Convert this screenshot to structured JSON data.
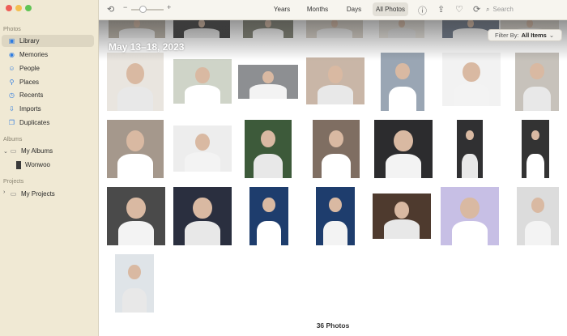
{
  "sidebar": {
    "sections": {
      "photos": "Photos",
      "albums": "Albums",
      "projects": "Projects"
    },
    "items": [
      {
        "label": "Library",
        "icon": "library-icon",
        "selected": true
      },
      {
        "label": "Memories",
        "icon": "memories-icon"
      },
      {
        "label": "People",
        "icon": "people-icon"
      },
      {
        "label": "Places",
        "icon": "places-icon"
      },
      {
        "label": "Recents",
        "icon": "recents-icon"
      },
      {
        "label": "Imports",
        "icon": "imports-icon"
      },
      {
        "label": "Duplicates",
        "icon": "duplicates-icon"
      }
    ],
    "my_albums": "My Albums",
    "album_wonwoo": "Wonwoo",
    "my_projects": "My Projects"
  },
  "toolbar": {
    "zoom_minus": "−",
    "zoom_plus": "+",
    "tabs": [
      {
        "label": "Years"
      },
      {
        "label": "Months"
      },
      {
        "label": "Days"
      },
      {
        "label": "All Photos",
        "selected": true
      }
    ],
    "search_placeholder": "Search"
  },
  "content": {
    "date_title": "May 13–18, 2023",
    "filter_label": "Filter By:",
    "filter_value": "All Items",
    "photo_count": "36 Photos"
  },
  "colors": {
    "sidebar_bg": "#f0e9d4",
    "selected_bg": "#ddd6c2",
    "accent": "#2f7ce0"
  }
}
